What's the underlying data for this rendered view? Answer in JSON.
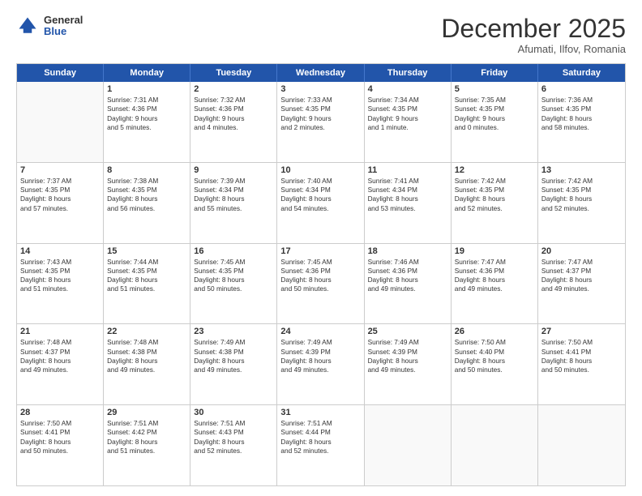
{
  "logo": {
    "general": "General",
    "blue": "Blue"
  },
  "title": "December 2025",
  "subtitle": "Afumati, Ilfov, Romania",
  "header_days": [
    "Sunday",
    "Monday",
    "Tuesday",
    "Wednesday",
    "Thursday",
    "Friday",
    "Saturday"
  ],
  "rows": [
    [
      {
        "day": "",
        "lines": [],
        "empty": true
      },
      {
        "day": "1",
        "lines": [
          "Sunrise: 7:31 AM",
          "Sunset: 4:36 PM",
          "Daylight: 9 hours",
          "and 5 minutes."
        ]
      },
      {
        "day": "2",
        "lines": [
          "Sunrise: 7:32 AM",
          "Sunset: 4:36 PM",
          "Daylight: 9 hours",
          "and 4 minutes."
        ]
      },
      {
        "day": "3",
        "lines": [
          "Sunrise: 7:33 AM",
          "Sunset: 4:35 PM",
          "Daylight: 9 hours",
          "and 2 minutes."
        ]
      },
      {
        "day": "4",
        "lines": [
          "Sunrise: 7:34 AM",
          "Sunset: 4:35 PM",
          "Daylight: 9 hours",
          "and 1 minute."
        ]
      },
      {
        "day": "5",
        "lines": [
          "Sunrise: 7:35 AM",
          "Sunset: 4:35 PM",
          "Daylight: 9 hours",
          "and 0 minutes."
        ]
      },
      {
        "day": "6",
        "lines": [
          "Sunrise: 7:36 AM",
          "Sunset: 4:35 PM",
          "Daylight: 8 hours",
          "and 58 minutes."
        ]
      }
    ],
    [
      {
        "day": "7",
        "lines": [
          "Sunrise: 7:37 AM",
          "Sunset: 4:35 PM",
          "Daylight: 8 hours",
          "and 57 minutes."
        ]
      },
      {
        "day": "8",
        "lines": [
          "Sunrise: 7:38 AM",
          "Sunset: 4:35 PM",
          "Daylight: 8 hours",
          "and 56 minutes."
        ]
      },
      {
        "day": "9",
        "lines": [
          "Sunrise: 7:39 AM",
          "Sunset: 4:34 PM",
          "Daylight: 8 hours",
          "and 55 minutes."
        ]
      },
      {
        "day": "10",
        "lines": [
          "Sunrise: 7:40 AM",
          "Sunset: 4:34 PM",
          "Daylight: 8 hours",
          "and 54 minutes."
        ]
      },
      {
        "day": "11",
        "lines": [
          "Sunrise: 7:41 AM",
          "Sunset: 4:34 PM",
          "Daylight: 8 hours",
          "and 53 minutes."
        ]
      },
      {
        "day": "12",
        "lines": [
          "Sunrise: 7:42 AM",
          "Sunset: 4:35 PM",
          "Daylight: 8 hours",
          "and 52 minutes."
        ]
      },
      {
        "day": "13",
        "lines": [
          "Sunrise: 7:42 AM",
          "Sunset: 4:35 PM",
          "Daylight: 8 hours",
          "and 52 minutes."
        ]
      }
    ],
    [
      {
        "day": "14",
        "lines": [
          "Sunrise: 7:43 AM",
          "Sunset: 4:35 PM",
          "Daylight: 8 hours",
          "and 51 minutes."
        ]
      },
      {
        "day": "15",
        "lines": [
          "Sunrise: 7:44 AM",
          "Sunset: 4:35 PM",
          "Daylight: 8 hours",
          "and 51 minutes."
        ]
      },
      {
        "day": "16",
        "lines": [
          "Sunrise: 7:45 AM",
          "Sunset: 4:35 PM",
          "Daylight: 8 hours",
          "and 50 minutes."
        ]
      },
      {
        "day": "17",
        "lines": [
          "Sunrise: 7:45 AM",
          "Sunset: 4:36 PM",
          "Daylight: 8 hours",
          "and 50 minutes."
        ]
      },
      {
        "day": "18",
        "lines": [
          "Sunrise: 7:46 AM",
          "Sunset: 4:36 PM",
          "Daylight: 8 hours",
          "and 49 minutes."
        ]
      },
      {
        "day": "19",
        "lines": [
          "Sunrise: 7:47 AM",
          "Sunset: 4:36 PM",
          "Daylight: 8 hours",
          "and 49 minutes."
        ]
      },
      {
        "day": "20",
        "lines": [
          "Sunrise: 7:47 AM",
          "Sunset: 4:37 PM",
          "Daylight: 8 hours",
          "and 49 minutes."
        ]
      }
    ],
    [
      {
        "day": "21",
        "lines": [
          "Sunrise: 7:48 AM",
          "Sunset: 4:37 PM",
          "Daylight: 8 hours",
          "and 49 minutes."
        ]
      },
      {
        "day": "22",
        "lines": [
          "Sunrise: 7:48 AM",
          "Sunset: 4:38 PM",
          "Daylight: 8 hours",
          "and 49 minutes."
        ]
      },
      {
        "day": "23",
        "lines": [
          "Sunrise: 7:49 AM",
          "Sunset: 4:38 PM",
          "Daylight: 8 hours",
          "and 49 minutes."
        ]
      },
      {
        "day": "24",
        "lines": [
          "Sunrise: 7:49 AM",
          "Sunset: 4:39 PM",
          "Daylight: 8 hours",
          "and 49 minutes."
        ]
      },
      {
        "day": "25",
        "lines": [
          "Sunrise: 7:49 AM",
          "Sunset: 4:39 PM",
          "Daylight: 8 hours",
          "and 49 minutes."
        ]
      },
      {
        "day": "26",
        "lines": [
          "Sunrise: 7:50 AM",
          "Sunset: 4:40 PM",
          "Daylight: 8 hours",
          "and 50 minutes."
        ]
      },
      {
        "day": "27",
        "lines": [
          "Sunrise: 7:50 AM",
          "Sunset: 4:41 PM",
          "Daylight: 8 hours",
          "and 50 minutes."
        ]
      }
    ],
    [
      {
        "day": "28",
        "lines": [
          "Sunrise: 7:50 AM",
          "Sunset: 4:41 PM",
          "Daylight: 8 hours",
          "and 50 minutes."
        ]
      },
      {
        "day": "29",
        "lines": [
          "Sunrise: 7:51 AM",
          "Sunset: 4:42 PM",
          "Daylight: 8 hours",
          "and 51 minutes."
        ]
      },
      {
        "day": "30",
        "lines": [
          "Sunrise: 7:51 AM",
          "Sunset: 4:43 PM",
          "Daylight: 8 hours",
          "and 52 minutes."
        ]
      },
      {
        "day": "31",
        "lines": [
          "Sunrise: 7:51 AM",
          "Sunset: 4:44 PM",
          "Daylight: 8 hours",
          "and 52 minutes."
        ]
      },
      {
        "day": "",
        "lines": [],
        "empty": true
      },
      {
        "day": "",
        "lines": [],
        "empty": true
      },
      {
        "day": "",
        "lines": [],
        "empty": true
      }
    ]
  ]
}
